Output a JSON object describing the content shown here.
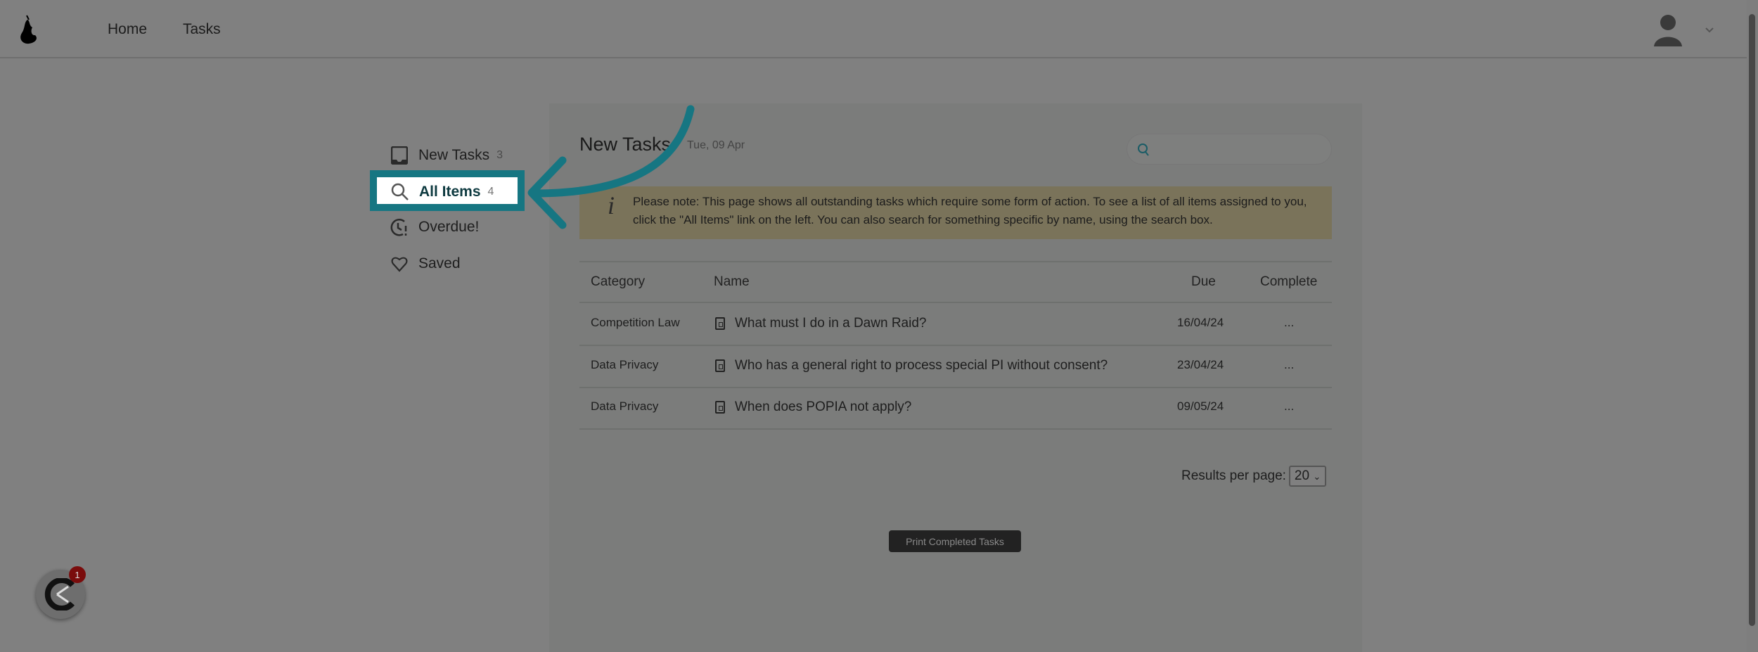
{
  "header": {
    "nav": [
      "Home",
      "Tasks"
    ]
  },
  "sidebar": {
    "items": [
      {
        "label": "New Tasks",
        "count": "3",
        "icon": "inbox-icon"
      },
      {
        "label": "All Items",
        "count": "4",
        "icon": "search-icon"
      },
      {
        "label": "Overdue!",
        "icon": "clock-alert-icon"
      },
      {
        "label": "Saved",
        "icon": "heart-icon"
      }
    ]
  },
  "main": {
    "title": "New Tasks",
    "date": "Tue, 09 Apr",
    "search": {
      "placeholder": ""
    },
    "note": "Please note: This page shows all outstanding tasks which require some form of action. To see a list of all items assigned to you, click the \"All Items\" link on the left. You can also search for something specific by name, using the search box.",
    "table": {
      "headers": [
        "Category",
        "Name",
        "Due",
        "Complete"
      ],
      "rows": [
        {
          "category": "Competition Law",
          "name": "What must I do in a Dawn Raid?",
          "due": "16/04/24",
          "complete": "..."
        },
        {
          "category": "Data Privacy",
          "name": "Who has a general right to process special PI without consent?",
          "due": "23/04/24",
          "complete": "..."
        },
        {
          "category": "Data Privacy",
          "name": "When does POPIA not apply?",
          "due": "09/05/24",
          "complete": "..."
        }
      ]
    },
    "results_per_page": {
      "label": "Results per page:",
      "value": "20"
    },
    "print_button": "Print Completed Tasks"
  },
  "chat_widget": {
    "badge": "1"
  },
  "colors": {
    "highlight": "#167682",
    "overlay": "#808080",
    "note_bg": "#7a735a"
  }
}
